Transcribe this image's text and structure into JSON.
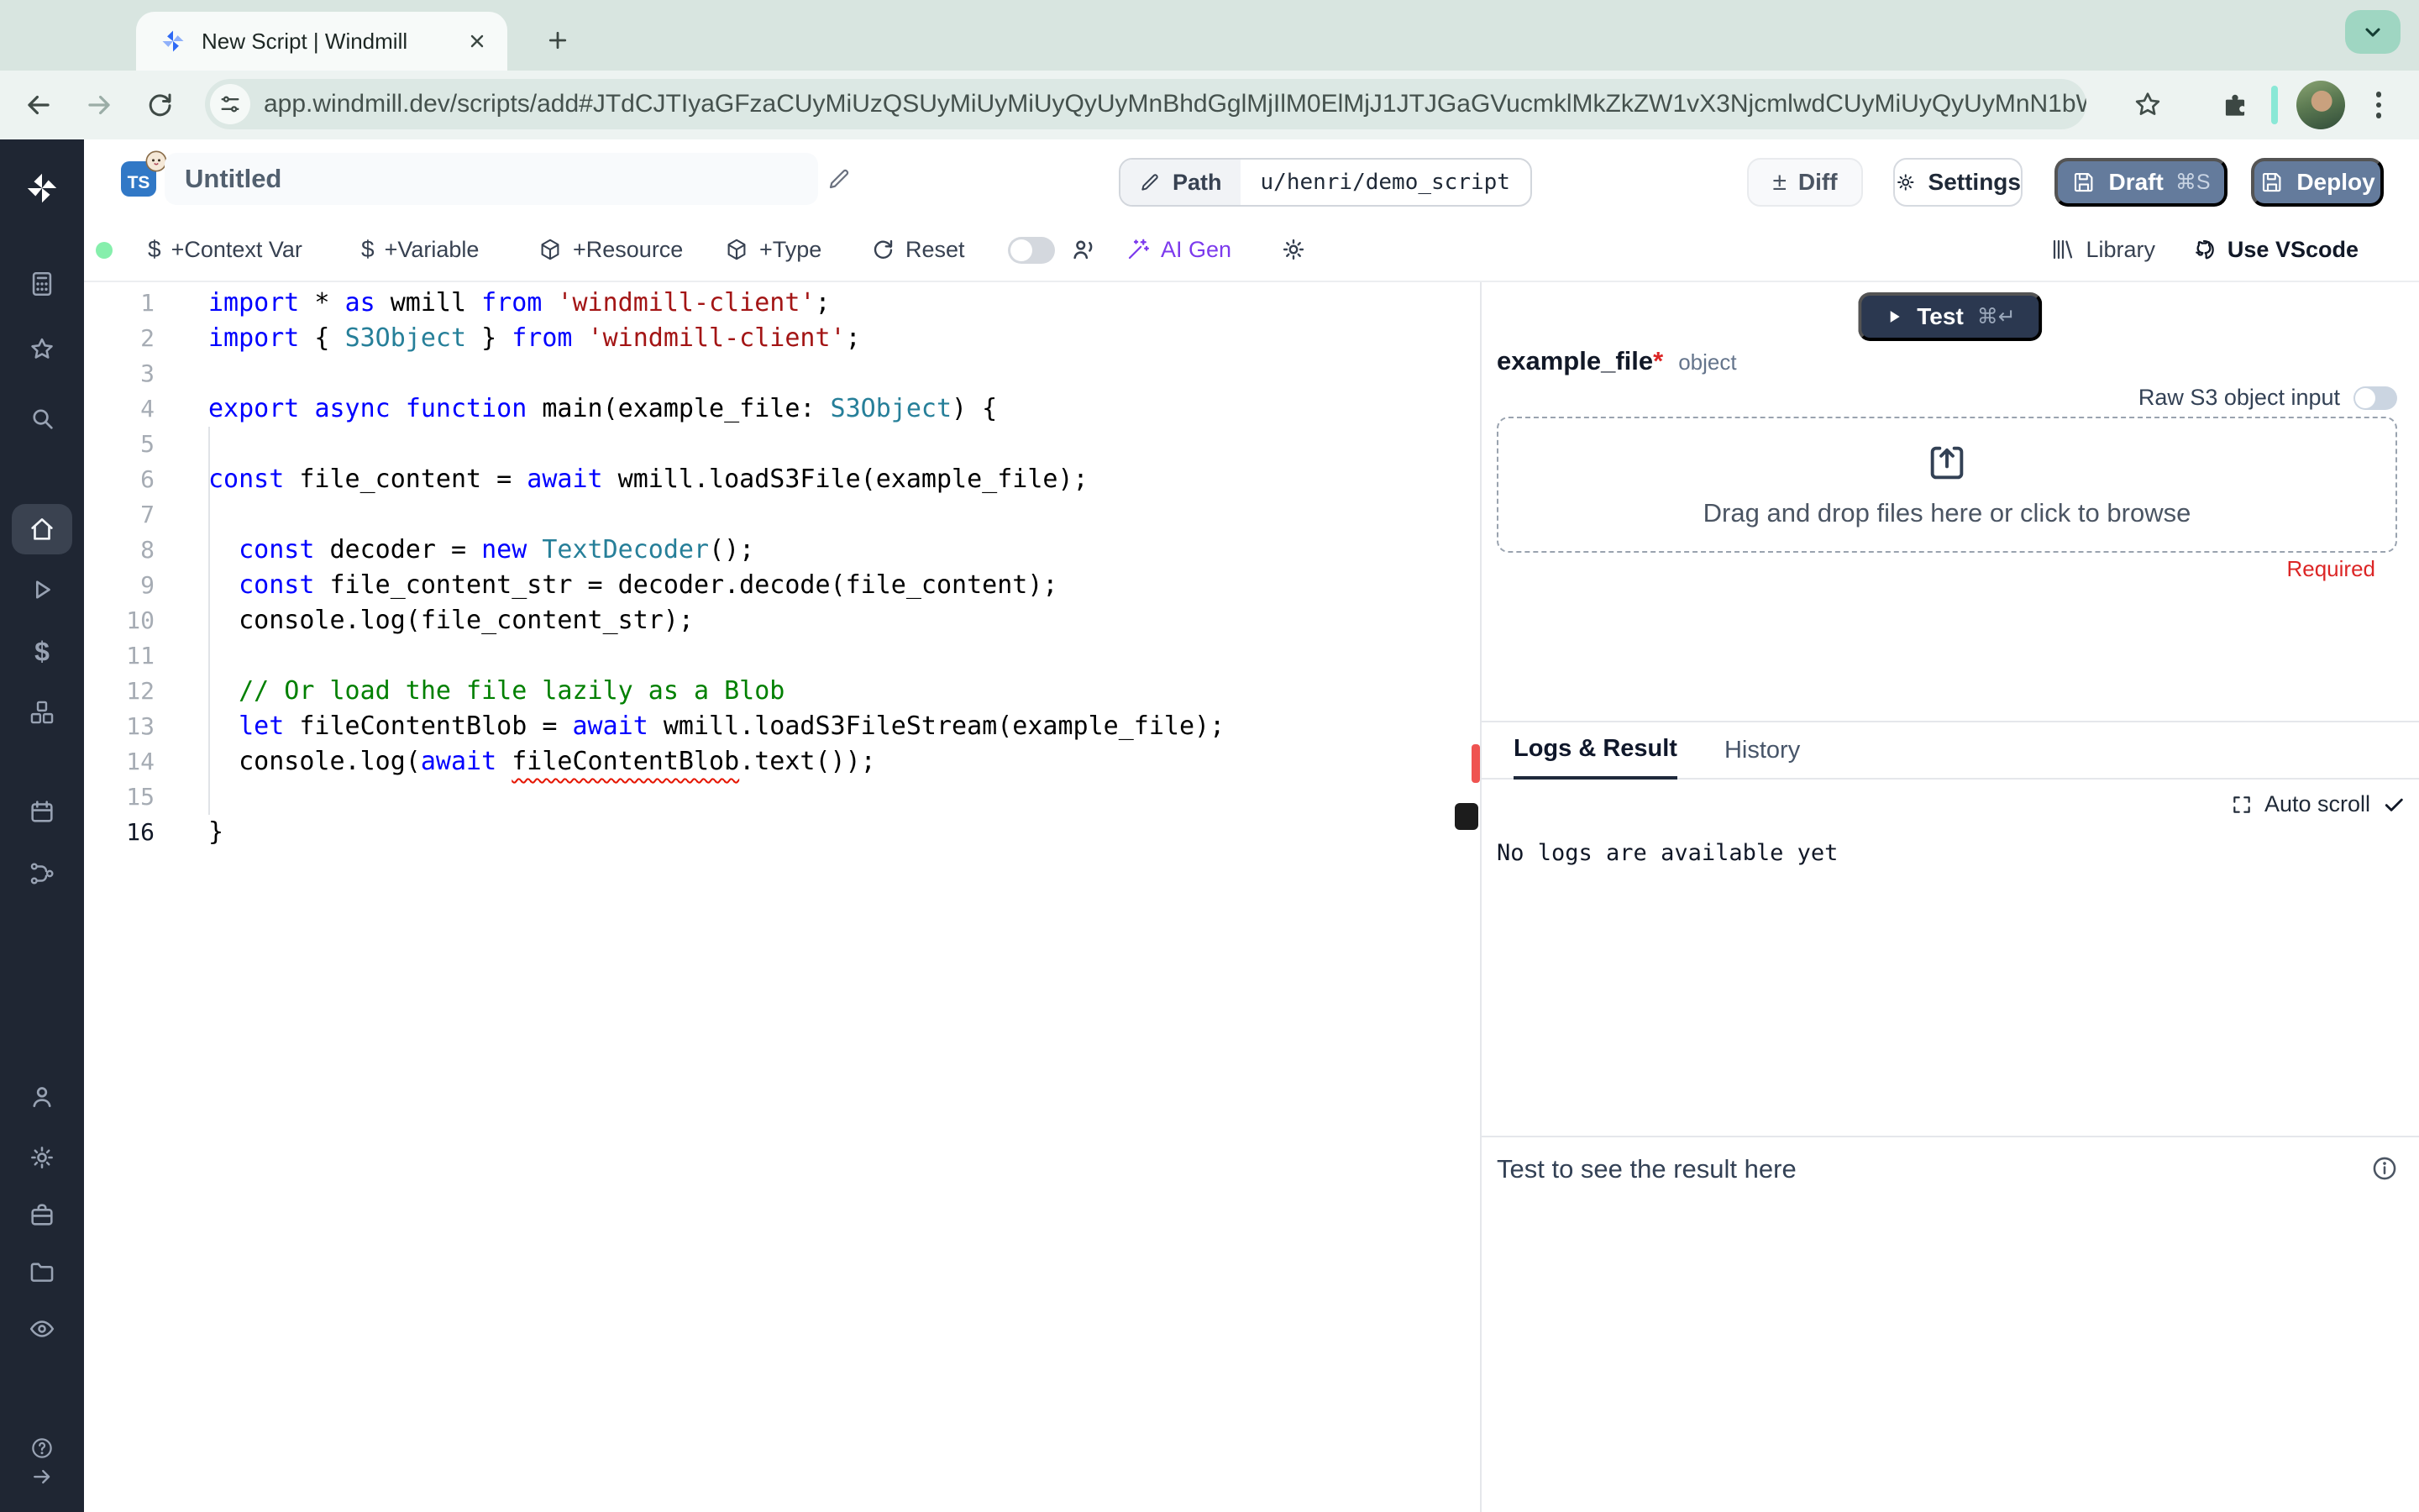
{
  "browser": {
    "tab_title": "New Script | Windmill",
    "url": "app.windmill.dev/scripts/add#JTdCJTIyaGFzaCUyMiUzQSUyMiUyMiUyQyUyMnBhdGglMjIlM0ElMjJ1JTJGaGVucmklMkZkZW1vX3NjcmlwdCUyMiUyQyUyMnN1bW1hc…"
  },
  "header": {
    "lang_badge": "TS",
    "title_value": "Untitled",
    "path_label": "Path",
    "path_value": "u/henri/demo_script",
    "diff_symbol": "±",
    "diff_label": "Diff",
    "settings_label": "Settings",
    "draft_label": "Draft",
    "draft_shortcut": "⌘S",
    "deploy_label": "Deploy"
  },
  "toolbar": {
    "context_var": "+Context Var",
    "variable": "+Variable",
    "resource": "+Resource",
    "type": "+Type",
    "reset": "Reset",
    "ai_gen": "AI Gen",
    "library": "Library",
    "use_vscode": "Use VScode",
    "dollar_symbol": "$"
  },
  "editor": {
    "language": "typescript",
    "lines": [
      {
        "n": 1,
        "t": [
          {
            "c": "kw",
            "s": "import"
          },
          {
            "c": "pl",
            "s": " * "
          },
          {
            "c": "kw",
            "s": "as"
          },
          {
            "c": "pl",
            "s": " wmill "
          },
          {
            "c": "kw",
            "s": "from"
          },
          {
            "c": "pl",
            "s": " "
          },
          {
            "c": "str",
            "s": "'windmill-client'"
          },
          {
            "c": "pl",
            "s": ";"
          }
        ]
      },
      {
        "n": 2,
        "t": [
          {
            "c": "kw",
            "s": "import"
          },
          {
            "c": "pl",
            "s": " { "
          },
          {
            "c": "ty",
            "s": "S3Object"
          },
          {
            "c": "pl",
            "s": " } "
          },
          {
            "c": "kw",
            "s": "from"
          },
          {
            "c": "pl",
            "s": " "
          },
          {
            "c": "str",
            "s": "'windmill-client'"
          },
          {
            "c": "pl",
            "s": ";"
          }
        ]
      },
      {
        "n": 3,
        "t": []
      },
      {
        "n": 4,
        "t": [
          {
            "c": "kw",
            "s": "export"
          },
          {
            "c": "pl",
            "s": " "
          },
          {
            "c": "kw",
            "s": "async"
          },
          {
            "c": "pl",
            "s": " "
          },
          {
            "c": "kw",
            "s": "function"
          },
          {
            "c": "pl",
            "s": " main(example_file: "
          },
          {
            "c": "ty",
            "s": "S3Object"
          },
          {
            "c": "pl",
            "s": ") {"
          }
        ]
      },
      {
        "n": 5,
        "t": []
      },
      {
        "n": 6,
        "t": [
          {
            "c": "kw",
            "s": "const"
          },
          {
            "c": "pl",
            "s": " file_content = "
          },
          {
            "c": "kw",
            "s": "await"
          },
          {
            "c": "pl",
            "s": " wmill.loadS3File(example_file);"
          }
        ]
      },
      {
        "n": 7,
        "t": []
      },
      {
        "n": 8,
        "t": [
          {
            "c": "pl",
            "s": "  "
          },
          {
            "c": "kw",
            "s": "const"
          },
          {
            "c": "pl",
            "s": " decoder = "
          },
          {
            "c": "kw",
            "s": "new"
          },
          {
            "c": "pl",
            "s": " "
          },
          {
            "c": "ty",
            "s": "TextDecoder"
          },
          {
            "c": "pl",
            "s": "();"
          }
        ]
      },
      {
        "n": 9,
        "t": [
          {
            "c": "pl",
            "s": "  "
          },
          {
            "c": "kw",
            "s": "const"
          },
          {
            "c": "pl",
            "s": " file_content_str = decoder.decode(file_content);"
          }
        ]
      },
      {
        "n": 10,
        "t": [
          {
            "c": "pl",
            "s": "  console.log(file_content_str);"
          }
        ]
      },
      {
        "n": 11,
        "t": []
      },
      {
        "n": 12,
        "t": [
          {
            "c": "cm",
            "s": "  // Or load the file lazily as a Blob"
          }
        ]
      },
      {
        "n": 13,
        "t": [
          {
            "c": "pl",
            "s": "  "
          },
          {
            "c": "kw",
            "s": "let"
          },
          {
            "c": "pl",
            "s": " fileContentBlob = "
          },
          {
            "c": "kw",
            "s": "await"
          },
          {
            "c": "pl",
            "s": " wmill.loadS3FileStream(example_file);"
          }
        ]
      },
      {
        "n": 14,
        "t": [
          {
            "c": "pl",
            "s": "  console.log("
          },
          {
            "c": "kw",
            "s": "await"
          },
          {
            "c": "pl",
            "s": " "
          },
          {
            "c": "err",
            "s": "fileContentBlob"
          },
          {
            "c": "pl",
            "s": ".text());"
          }
        ]
      },
      {
        "n": 15,
        "t": []
      },
      {
        "n": 16,
        "active": true,
        "t": [
          {
            "c": "pl",
            "s": "}"
          }
        ]
      }
    ]
  },
  "panel": {
    "test_label": "Test",
    "test_shortcut": "⌘↵",
    "arg_name": "example_file",
    "arg_required_mark": "*",
    "arg_type": "object",
    "raw_s3_label": "Raw S3 object input",
    "dropzone_text": "Drag and drop files here or click to browse",
    "required_label": "Required",
    "tabs": {
      "logs": "Logs & Result",
      "history": "History"
    },
    "auto_scroll_label": "Auto scroll",
    "no_logs_text": "No logs are available yet",
    "result_placeholder": "Test to see the result here"
  },
  "colors": {
    "draft_deploy_button": "#647b9c",
    "ai_gen": "#7c3aed",
    "required": "#dc2626",
    "sidebar_bg": "#1f2633",
    "status_dot": "#86efac",
    "code_keyword": "#0000ff",
    "code_string": "#a31515",
    "code_type": "#267f99",
    "code_comment": "#008000",
    "error_squiggle": "#e51400",
    "resize_handle": "#ef5350"
  },
  "sidebar_icon_names": [
    "windmill-logo-icon",
    "workspace-icon",
    "favorites-star-icon",
    "search-icon",
    "home-icon",
    "runs-play-icon",
    "variables-dollar-icon",
    "resources-boxes-icon",
    "schedules-calendar-icon",
    "routes-icon",
    "user-icon",
    "settings-gear-icon",
    "workers-briefcase-icon",
    "folders-icon",
    "audit-eye-icon",
    "help-icon",
    "collapse-sidebar-icon"
  ]
}
